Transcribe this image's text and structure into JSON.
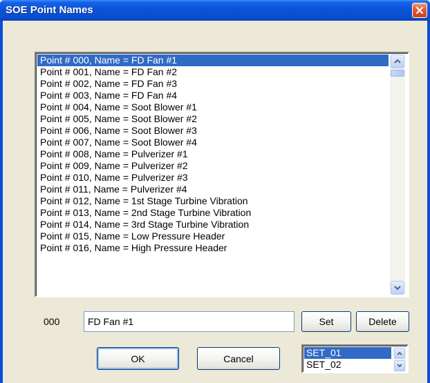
{
  "window": {
    "title": "SOE Point Names",
    "close_icon": "close-icon"
  },
  "points_list": {
    "selected_index": 0,
    "items": [
      "Point # 000, Name = FD Fan #1",
      "Point # 001, Name = FD Fan #2",
      "Point # 002, Name = FD Fan #3",
      "Point # 003, Name = FD Fan #4",
      "Point # 004, Name = Soot Blower #1",
      "Point # 005, Name = Soot Blower #2",
      "Point # 006, Name = Soot Blower #3",
      "Point # 007, Name = Soot Blower #4",
      "Point # 008, Name = Pulverizer #1",
      "Point # 009, Name = Pulverizer #2",
      "Point # 010, Name = Pulverizer #3",
      "Point # 011, Name = Pulverizer #4",
      "Point # 012, Name = 1st Stage Turbine Vibration",
      "Point # 013, Name = 2nd Stage Turbine Vibration",
      "Point # 014, Name = 3rd Stage Turbine Vibration",
      "Point # 015, Name = Low Pressure Header",
      "Point # 016, Name = High Pressure Header"
    ]
  },
  "editor": {
    "point_code": "000",
    "name_value": "FD Fan #1"
  },
  "buttons": {
    "set_label": "Set",
    "delete_label": "Delete",
    "ok_label": "OK",
    "cancel_label": "Cancel"
  },
  "set_list": {
    "selected_index": 0,
    "items": [
      "SET_01",
      "SET_02"
    ]
  },
  "colors": {
    "selection": "#316ac5",
    "title_bar": "#0a52d8",
    "dialog_face": "#ece9d8"
  }
}
